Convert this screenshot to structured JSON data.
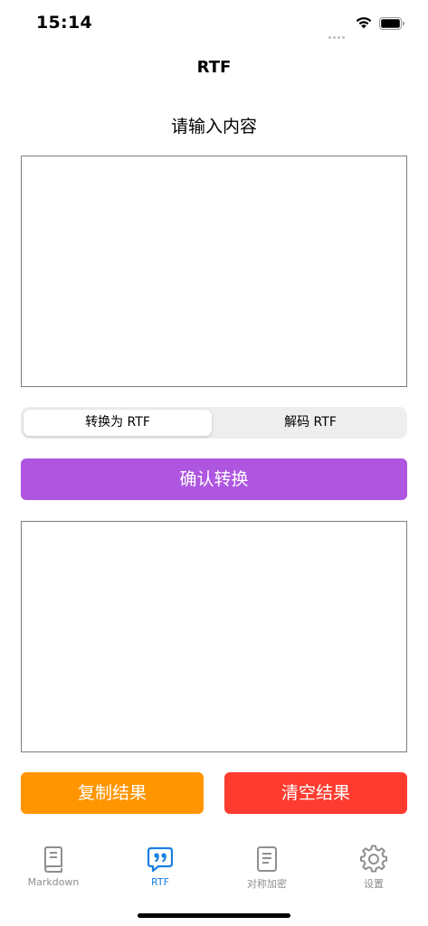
{
  "status_bar": {
    "time": "15:14",
    "wifi_icon": "wifi-icon",
    "battery_icon": "battery-icon"
  },
  "nav": {
    "title": "RTF"
  },
  "input": {
    "label": "请输入内容",
    "value": ""
  },
  "segmented": {
    "options": [
      "转换为 RTF",
      "解码 RTF"
    ],
    "selected": "转换为 RTF"
  },
  "convert_button": {
    "label": "确认转换",
    "color": "#ae56e0"
  },
  "output": {
    "value": ""
  },
  "actions": {
    "copy": {
      "label": "复制结果",
      "color": "#ff9500"
    },
    "clear": {
      "label": "清空结果",
      "color": "#ff3b30"
    }
  },
  "tab_bar": {
    "active": "RTF",
    "active_color": "#1a7fe0",
    "items": [
      {
        "label": "Markdown",
        "icon": "book-icon"
      },
      {
        "label": "RTF",
        "icon": "quote-bubble-icon"
      },
      {
        "label": "对称加密",
        "icon": "document-icon"
      },
      {
        "label": "设置",
        "icon": "gear-icon"
      }
    ]
  }
}
